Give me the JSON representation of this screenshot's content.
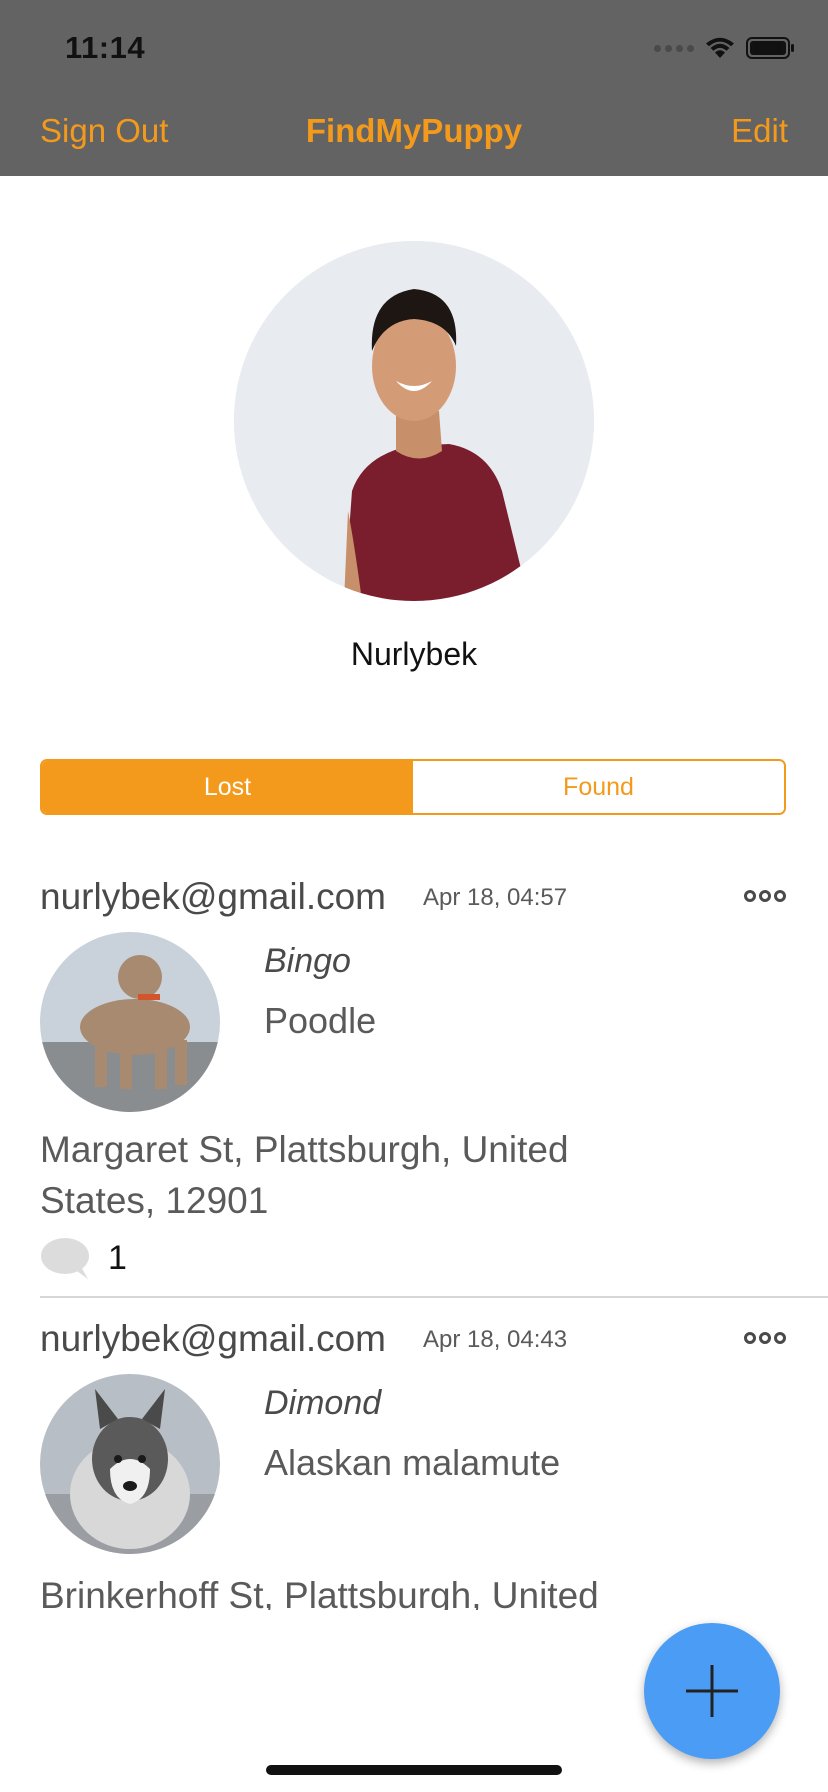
{
  "status_bar": {
    "time": "11:14"
  },
  "nav": {
    "left": "Sign Out",
    "title": "FindMyPuppy",
    "right": "Edit"
  },
  "profile": {
    "name": "Nurlybek"
  },
  "segmented": {
    "options": [
      "Lost",
      "Found"
    ],
    "selected": "Lost"
  },
  "posts": [
    {
      "email": "nurlybek@gmail.com",
      "date": "Apr 18, 04:57",
      "pet_name": "Bingo",
      "breed": "Poodle",
      "address": "Margaret St, Plattsburgh, United States, 12901",
      "comments": "1"
    },
    {
      "email": "nurlybek@gmail.com",
      "date": "Apr 18, 04:43",
      "pet_name": "Dimond",
      "breed": "Alaskan malamute",
      "address": "Brinkerhoff St, Plattsburgh, United"
    }
  ],
  "colors": {
    "accent": "#f39a1c",
    "nav_bg": "#636363",
    "fab": "#4a9cf4"
  },
  "icons": [
    "wifi-icon",
    "battery-icon",
    "more-icon",
    "comment-icon",
    "plus-icon"
  ]
}
